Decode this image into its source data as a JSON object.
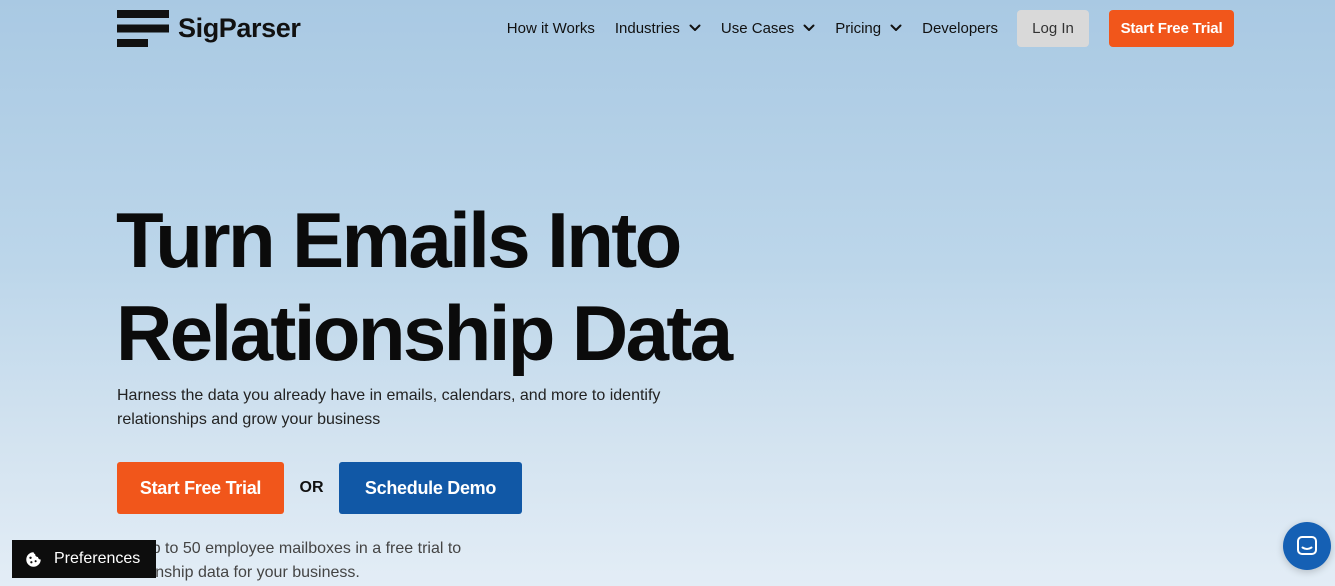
{
  "brand": {
    "name": "SigParser",
    "logo_icon": "stacked-bars-logo-icon"
  },
  "nav": {
    "items": [
      {
        "label": "How it Works",
        "dropdown": false
      },
      {
        "label": "Industries",
        "dropdown": true
      },
      {
        "label": "Use Cases",
        "dropdown": true
      },
      {
        "label": "Pricing",
        "dropdown": true
      },
      {
        "label": "Developers",
        "dropdown": false
      }
    ],
    "login_label": "Log In",
    "trial_label": "Start Free Trial"
  },
  "hero": {
    "title_line1": "Turn Emails Into",
    "title_line2": "Relationship Data",
    "subtitle": "Harness the data you already have in emails, calendars, and more to identify relationships and grow your business",
    "cta_trial": "Start Free Trial",
    "or_text": "OR",
    "cta_demo": "Schedule Demo",
    "note_line1": "ect up to 50 employee mailboxes in a free trial to",
    "note_line2": "elationship data for your business."
  },
  "preferences": {
    "label": "Preferences",
    "icon": "cookie-icon"
  },
  "chat": {
    "icon": "chat-bubble-icon"
  },
  "colors": {
    "accent_orange": "#f1561b",
    "accent_blue": "#1158a6",
    "chat_blue": "#1560b4",
    "login_gray": "#d9d9d9",
    "text_dark": "#111111"
  }
}
